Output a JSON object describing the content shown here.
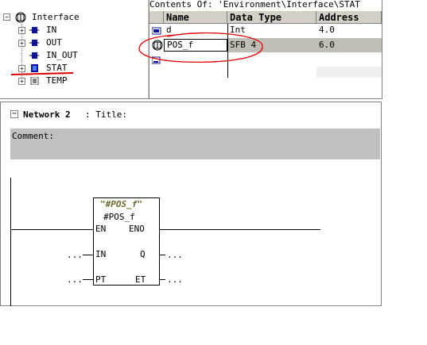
{
  "tree": {
    "root_label": "Interface",
    "items": [
      {
        "label": "IN",
        "expand": "+"
      },
      {
        "label": "OUT",
        "expand": "+"
      },
      {
        "label": "IN_OUT",
        "expand": ""
      },
      {
        "label": "STAT",
        "expand": "+"
      },
      {
        "label": "TEMP",
        "expand": "+"
      }
    ]
  },
  "contents_header": "Contents Of: 'Environment\\Interface\\STAT",
  "table": {
    "columns": [
      "Name",
      "Data Type",
      "Address"
    ],
    "rows": [
      {
        "name": "d",
        "type": "Int",
        "address": "4.0"
      },
      {
        "name": "POS_f",
        "type": "SFB 4",
        "address": "6.0"
      },
      {
        "name": "",
        "type": "",
        "address": ""
      }
    ]
  },
  "network": {
    "expand": "−",
    "label": "Network 2",
    "title": ": Title:",
    "comment_label": "Comment:"
  },
  "block": {
    "instance": "\"#POS_f\"",
    "name": "#POS_f",
    "pins": {
      "en": "EN",
      "eno": "ENO",
      "in": "IN",
      "q": "Q",
      "pt": "PT",
      "et": "ET"
    },
    "dots": "..."
  },
  "colors": {
    "selected_row": "#c0bdb6",
    "comment_bg": "#c0c0c0",
    "header_bg": "#d4d0c8",
    "annotation_red": "#e00000",
    "block_instance": "#6b6b2a"
  }
}
